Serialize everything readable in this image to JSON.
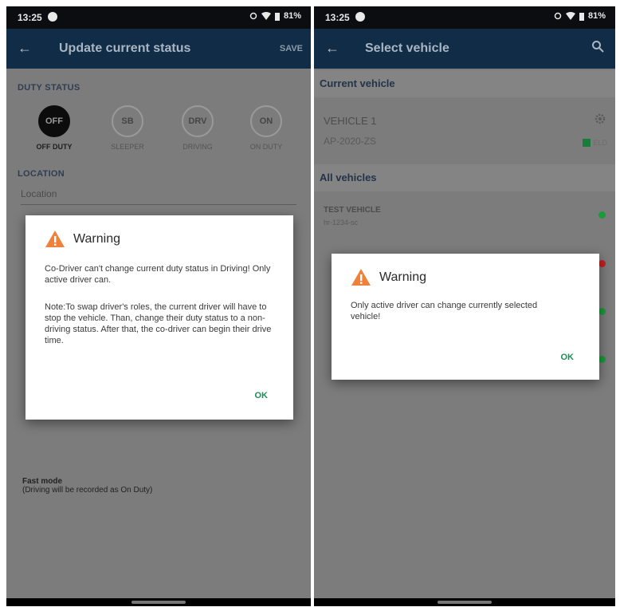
{
  "left": {
    "status_bar": {
      "time": "13:25",
      "battery": "81%"
    },
    "app_bar": {
      "title": "Update current status",
      "save": "SAVE"
    },
    "duty_status": {
      "label": "DUTY STATUS",
      "options": [
        {
          "code": "OFF",
          "caption": "OFF DUTY",
          "active": true
        },
        {
          "code": "SB",
          "caption": "SLEEPER",
          "active": false
        },
        {
          "code": "DRV",
          "caption": "DRIVING",
          "active": false
        },
        {
          "code": "ON",
          "caption": "ON DUTY",
          "active": false
        }
      ]
    },
    "location": {
      "label": "LOCATION",
      "placeholder": "Location"
    },
    "fast_mode": {
      "title": "Fast mode",
      "subtitle": "(Driving will be recorded as On Duty)"
    },
    "dialog": {
      "title": "Warning",
      "message": "Co-Driver can't change current duty status in Driving! Only active driver can.",
      "note": "Note:To swap driver's roles, the current driver will have to stop the vehicle. Than, change their duty status to a non-driving status. After that, the co-driver can begin their drive time.",
      "ok": "OK"
    }
  },
  "right": {
    "status_bar": {
      "time": "13:25",
      "battery": "81%"
    },
    "app_bar": {
      "title": "Select vehicle"
    },
    "current_vehicle": {
      "section": "Current vehicle",
      "name": "VEHICLE 1",
      "plate": "AP-2020-ZS",
      "eld": "ELD"
    },
    "all_vehicles": {
      "section": "All vehicles",
      "first": {
        "name": "TEST VEHICLE",
        "plate": "hr-1234-sc",
        "status_color": "#1b9a3a"
      },
      "dot_colors": [
        "#c62020",
        "#1b9a3a",
        "#1b9a3a"
      ]
    },
    "dialog": {
      "title": "Warning",
      "message": "Only active driver can change currently selected vehicle!",
      "ok": "OK"
    }
  },
  "colors": {
    "app_bar": "#102c47",
    "warning_orange": "#f0813a",
    "ok_green": "#1f8c5a"
  }
}
